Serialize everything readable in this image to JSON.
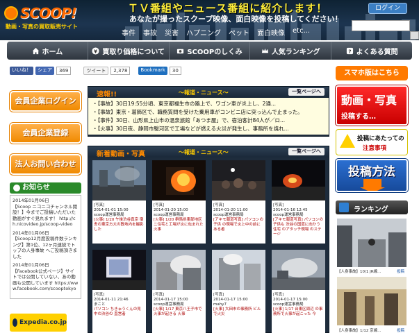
{
  "header": {
    "logo": "SCOOP!",
    "logo_sub": "動画・写真の買取販売サイト",
    "title": "ＴＶ番組やニュース番組に紹介します！",
    "subtitle": "あなたが撮ったスクープ映像、面白映像を投稿してください！",
    "categories": [
      "事件",
      "事故",
      "災害",
      "ハプニング",
      "ペット",
      "面白映像",
      "etc..."
    ],
    "login_label": "ログイン",
    "search_placeholder": ""
  },
  "nav": {
    "items": [
      {
        "label": "ホーム",
        "icon": "home-icon"
      },
      {
        "label": "買取り価格について",
        "icon": "yen-icon"
      },
      {
        "label": "SCOOPのしくみ",
        "icon": "camera-icon"
      },
      {
        "label": "人気ランキング",
        "icon": "crown-icon"
      },
      {
        "label": "よくある質問",
        "icon": "question-icon"
      }
    ]
  },
  "social": {
    "like": "いいね！",
    "share": "シェア",
    "share_count": "369",
    "tweet": "ツイート",
    "tweet_count": "2,378",
    "bookmark": "Bookmark",
    "bookmark_count": "30"
  },
  "left": {
    "member_login": "会員企業ログイン",
    "member_register": "会員企業登録",
    "contact": "法人お問い合わせ",
    "news_heading": "お知らせ",
    "news": [
      {
        "date": "2014年01月06日",
        "text": "【Scoop ニコニコチャンネル開設！】今までご投稿いただいた動画がすぐ見れます！ http://ch.nicovideo.jp/scoop-video"
      },
      {
        "date": "2014年01月06日",
        "text": "【Scoop12月度投稿件数ランキング】第1位、12ヶ月連続でトップの人身事故 へご投稿頂きました"
      },
      {
        "date": "2014年01月06日",
        "text": "【Facebook公式ページ】サイトでは公開していない、あの動画も公開しています https://www.facebook.com/scooptokyo"
      }
    ],
    "ad_label": "Expedia.co.jp"
  },
  "breaking": {
    "heading": "速報!!",
    "sub": "～報道・ニュース～",
    "more": "一覧ページへ",
    "items": [
      "・【事故】30日19:55分頃、東京都福生市の路上で、ワゴン車が炎上し、2通...",
      "・【事故】東京・葛飾区で、職務質問を受けた乗用車がコンビニ店に突っ込んで止まった。",
      "・【事件】30日、山形県上山市の温泉旅館「あつま屋」で、宿泊客計84人が／ロ...",
      "・【火事】30日夜、静岡市駿河区で工場などが燃える火災が発生し、事務所を焼れ..."
    ]
  },
  "videos": {
    "heading": "新着動画・写真",
    "sub": "～報道・ニュース～",
    "more": "一覧ページへ",
    "cards": [
      {
        "type": "[写真]",
        "date": "2014-01-01 15:00",
        "user": "scoop運営事務局",
        "title": "[火事] 1/20 午後渋谷真宗 宿舎の東京方大の敷地内を撮影した"
      },
      {
        "type": "[写真]",
        "date": "2014-01-20 15:00",
        "user": "scoop運営事務局",
        "title": "[火事] 1/20 群馬県東部地区 ニ住宅と工場が炎に包まれた火事"
      },
      {
        "type": "[写真]",
        "date": "2014-01-20 11:00",
        "user": "scoop運営事務局",
        "title": "[アキモ報道写真] パソコンの子供 の現場で炎上中の前にある者"
      },
      {
        "type": "[写真]",
        "date": "2014-01-16 12:45",
        "user": "scoop運営事務局",
        "title": "[アキモ報道写真] パソコンの子供も 渋谷の国道に向かう住宅 のアタッチ現場 のステージ"
      },
      {
        "type": "[写真]",
        "date": "2014-01-11 21:46",
        "user": "まこと",
        "title": "パソコン ちきゅうくんの見 中の渋谷の 直営者"
      },
      {
        "type": "[写真]",
        "date": "2014-01-17 15:00",
        "user": "scoop運営事務局",
        "title": "[火事] 1/17 東京八王子市で火事が起きる 火事"
      },
      {
        "type": "[写真]",
        "date": "2014-01-17 15:00",
        "user": "mahy7",
        "title": "[火事] 大田市の事務所 ビルで火災"
      },
      {
        "type": "[写真]",
        "date": "2014-01-17 15:00",
        "user": "scoop運営事務局",
        "title": "[火事] 1/17 台東区周辺 の事務所で火事が起こった 今"
      }
    ]
  },
  "right": {
    "smartphone": "スマホ版はこちら",
    "post_photo_1": "動画・写真",
    "post_photo_2": "投稿する…",
    "notice_1": "投稿にあたっての",
    "notice_2": "注意事項",
    "howto": "投稿方法",
    "ranking": "ランキング",
    "ranking_items": [
      {
        "caption": "【人身事故】10/1 JR線...",
        "more": "投稿"
      },
      {
        "caption": "【人身事故】1/12 京線...",
        "more": "投稿"
      }
    ]
  }
}
